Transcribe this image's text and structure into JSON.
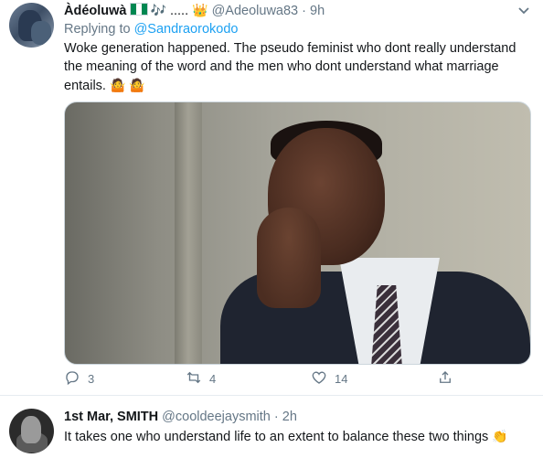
{
  "tweet1": {
    "name": "Àdéoluwà",
    "emoji_flag": "Nigeria flag",
    "emoji_notes": "🎶",
    "dots": ".....",
    "emoji_crown": "👑",
    "handle": "@Adeoluwa83",
    "separator": "·",
    "time": "9h",
    "replying_prefix": "Replying to",
    "replying_handle": "@Sandraorokodo",
    "text": "Woke  generation happened. The pseudo feminist who dont really understand the meaning of the word and the men who dont understand what marriage entails.",
    "text_emojis": "🤷 🤷",
    "media_alt": "photo of a young man in a suit resting his cheek on his hand, looking bored",
    "actions": {
      "reply_count": "3",
      "retweet_count": "4",
      "like_count": "14",
      "share_count": ""
    },
    "icons": {
      "reply": "reply-icon",
      "retweet": "retweet-icon",
      "like": "heart-icon",
      "share": "share-icon",
      "more": "chevron-down-icon"
    }
  },
  "tweet2": {
    "name": "1st Mar, SMITH",
    "handle": "@cooldeejaysmith",
    "separator": "·",
    "time": "2h",
    "text": "It takes one who understand life to an extent to balance these two things",
    "text_emoji": "👏"
  },
  "colors": {
    "link": "#1da1f2",
    "secondary_text": "#657786",
    "primary_text": "#14171a",
    "divider": "#e6ecf0"
  }
}
